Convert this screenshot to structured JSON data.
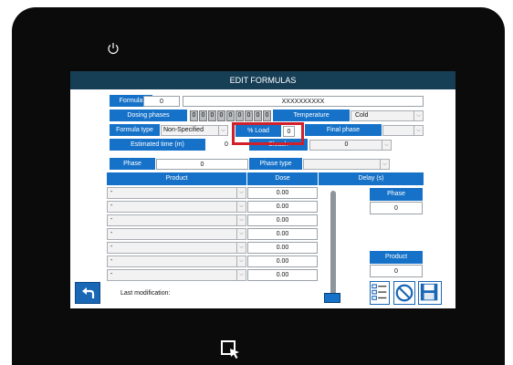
{
  "title": "EDIT FORMULAS",
  "formula": {
    "label": "Formula",
    "number": "0",
    "name": "XXXXXXXXXX"
  },
  "dosing": {
    "label": "Dosing phases",
    "digits": [
      "0",
      "0",
      "0",
      "0",
      "0",
      "0",
      "0",
      "0",
      "0"
    ]
  },
  "temperature": {
    "label": "Temperature",
    "value": "Cold"
  },
  "formula_type": {
    "label": "Formula type",
    "value": "Non-Specified"
  },
  "load": {
    "label": "% Load",
    "value": "0"
  },
  "final_phase": {
    "label": "Final phase",
    "value": ""
  },
  "estimated_time": {
    "label": "Estimated time (m)",
    "value": "0"
  },
  "bleach": {
    "label": "Bleach",
    "value": "0"
  },
  "phase": {
    "label": "Phase",
    "value": "0"
  },
  "phase_type": {
    "label": "Phase type",
    "value": ""
  },
  "table": {
    "headers": {
      "product": "Product",
      "dose": "Dose",
      "delay": "Delay (s)"
    },
    "rows": [
      {
        "product": "-",
        "dose": "0.00"
      },
      {
        "product": "-",
        "dose": "0.00"
      },
      {
        "product": "-",
        "dose": "0.00"
      },
      {
        "product": "-",
        "dose": "0.00"
      },
      {
        "product": "-",
        "dose": "0.00"
      },
      {
        "product": "-",
        "dose": "0.00"
      },
      {
        "product": "-",
        "dose": "0.00"
      }
    ]
  },
  "side_phase": {
    "label": "Phase",
    "value": "0"
  },
  "side_product": {
    "label": "Product",
    "value": "0"
  },
  "last_modification": {
    "label": "Last modification:"
  },
  "colors": {
    "accent": "#1672c8",
    "titlebar": "#163e55",
    "highlight": "#d0202b"
  }
}
